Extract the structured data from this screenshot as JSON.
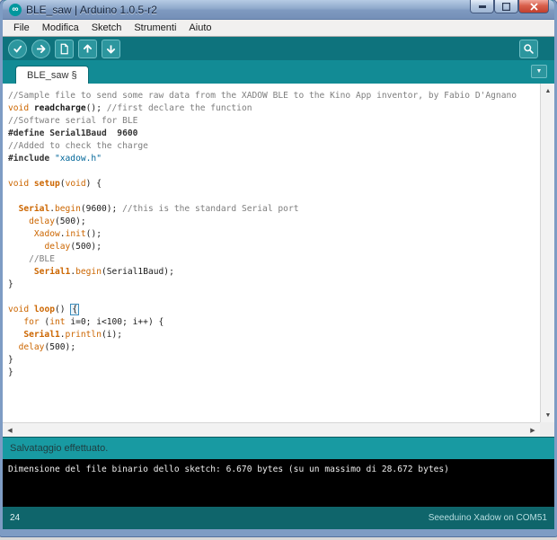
{
  "window": {
    "title": "BLE_saw | Arduino 1.0.5-r2"
  },
  "menubar": {
    "items": [
      "File",
      "Modifica",
      "Sketch",
      "Strumenti",
      "Aiuto"
    ]
  },
  "toolbar": {
    "buttons": [
      "verify",
      "upload",
      "new",
      "open",
      "save",
      "serial-monitor"
    ]
  },
  "tabbar": {
    "active_tab": "BLE_saw §"
  },
  "editor": {
    "lines": [
      [
        [
          "com",
          "//Sample file to send some raw data from the XADOW BLE to the Kino App inventor, by Fabio D'Agnano"
        ]
      ],
      [
        [
          "kw",
          "void"
        ],
        [
          "pln",
          " "
        ],
        [
          "plb",
          "readcharge"
        ],
        [
          "pln",
          "(); "
        ],
        [
          "com",
          "//first declare the function"
        ]
      ],
      [
        [
          "com",
          "//Software serial for BLE"
        ]
      ],
      [
        [
          "pre",
          "#define Serial1Baud  9600"
        ]
      ],
      [
        [
          "com",
          "//Added to check the charge"
        ]
      ],
      [
        [
          "pre",
          "#include "
        ],
        [
          "str",
          "\"xadow.h\""
        ]
      ],
      [],
      [
        [
          "kw",
          "void"
        ],
        [
          "pln",
          " "
        ],
        [
          "kwb",
          "setup"
        ],
        [
          "pln",
          "("
        ],
        [
          "kw",
          "void"
        ],
        [
          "pln",
          ") {"
        ]
      ],
      [],
      [
        [
          "pln",
          "  "
        ],
        [
          "kwb",
          "Serial"
        ],
        [
          "pln",
          "."
        ],
        [
          "kw",
          "begin"
        ],
        [
          "pln",
          "(9600); "
        ],
        [
          "com",
          "//this is the standard Serial port"
        ]
      ],
      [
        [
          "pln",
          "    "
        ],
        [
          "kw",
          "delay"
        ],
        [
          "pln",
          "(500);"
        ]
      ],
      [
        [
          "pln",
          "     "
        ],
        [
          "kw",
          "Xadow"
        ],
        [
          "pln",
          "."
        ],
        [
          "kw",
          "init"
        ],
        [
          "pln",
          "();"
        ]
      ],
      [
        [
          "pln",
          "       "
        ],
        [
          "kw",
          "delay"
        ],
        [
          "pln",
          "(500);"
        ]
      ],
      [
        [
          "pln",
          "    "
        ],
        [
          "com",
          "//BLE"
        ]
      ],
      [
        [
          "pln",
          "     "
        ],
        [
          "kwb",
          "Serial1"
        ],
        [
          "pln",
          "."
        ],
        [
          "kw",
          "begin"
        ],
        [
          "pln",
          "(Serial1Baud);"
        ]
      ],
      [
        [
          "pln",
          "}"
        ]
      ],
      [],
      [
        [
          "kw",
          "void"
        ],
        [
          "pln",
          " "
        ],
        [
          "kwb",
          "loop"
        ],
        [
          "pln",
          "() "
        ],
        [
          "hl",
          "{"
        ]
      ],
      [
        [
          "pln",
          "   "
        ],
        [
          "kw",
          "for"
        ],
        [
          "pln",
          " ("
        ],
        [
          "kw",
          "int"
        ],
        [
          "pln",
          " i=0; i<100; i++) {"
        ]
      ],
      [
        [
          "pln",
          "   "
        ],
        [
          "kwb",
          "Serial1"
        ],
        [
          "pln",
          "."
        ],
        [
          "kw",
          "println"
        ],
        [
          "pln",
          "(i);"
        ]
      ],
      [
        [
          "pln",
          "  "
        ],
        [
          "kw",
          "delay"
        ],
        [
          "pln",
          "(500);"
        ]
      ],
      [
        [
          "pln",
          "}"
        ]
      ],
      [
        [
          "pln",
          "}"
        ]
      ]
    ]
  },
  "statusbar": {
    "message": "Salvataggio effettuato."
  },
  "console": {
    "text": "Dimensione del file binario dello sketch: 6.670 bytes (su un massimo di 28.672 bytes)"
  },
  "footer": {
    "line_number": "24",
    "board_port": "Seeeduino Xadow on COM51"
  },
  "colors": {
    "toolbar_teal": "#0E737D",
    "tabbar_teal": "#128B95",
    "status_teal": "#189AA2",
    "footer_teal": "#0F656B",
    "button_fill": "#2C969E",
    "keyword_orange": "#CC6600",
    "comment_gray": "#7E7E7E",
    "string_blue": "#006699",
    "console_bg": "#000000",
    "titlebar_blue": "#8FA9CB"
  }
}
